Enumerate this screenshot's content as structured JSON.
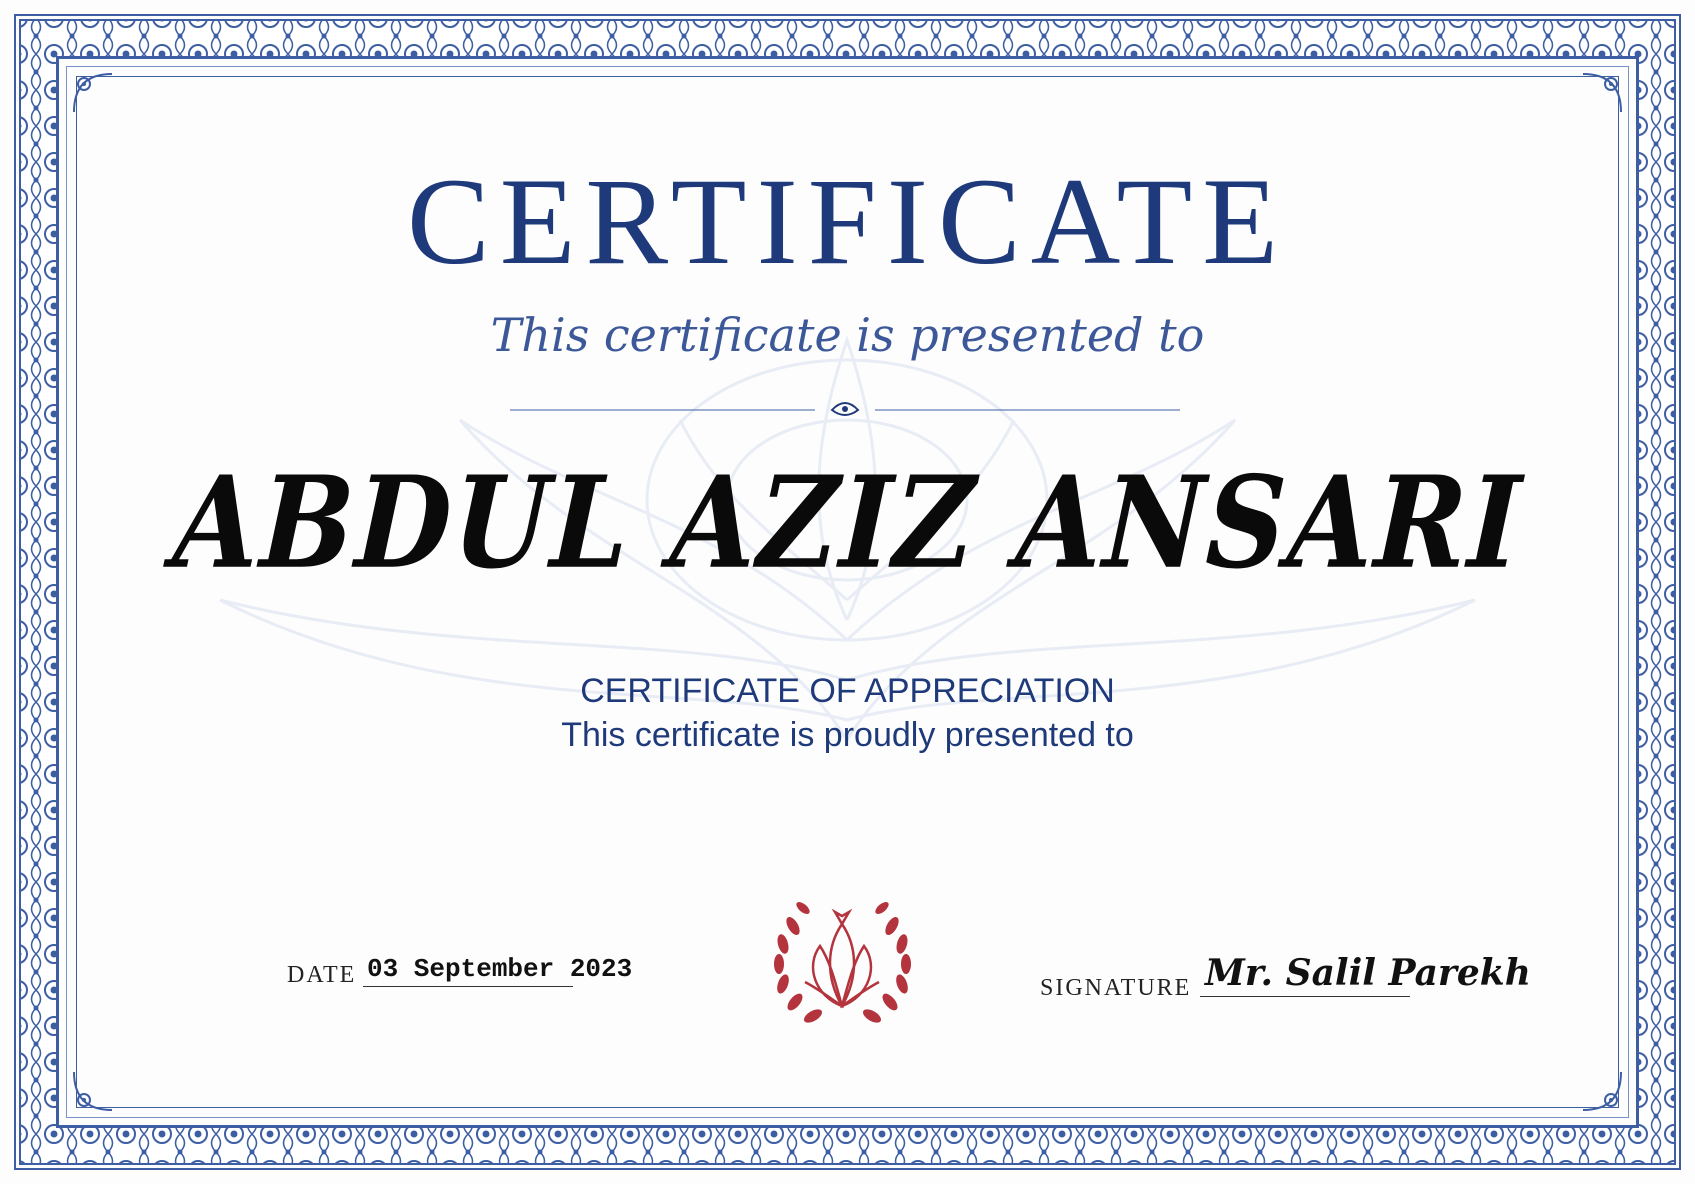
{
  "certificate": {
    "title": "CERTIFICATE",
    "subtitle": "This certificate is presented to",
    "recipient_name": "ABDUL AZIZ ANSARI",
    "appreciation": "CERTIFICATE OF APPRECIATION",
    "proudly_presented": "This certificate is proudly presented to",
    "date_label": "DATE",
    "date_value": "03 September 2023",
    "signature_label": "SIGNATURE",
    "signature_value": "Mr. Salil Parekh"
  },
  "colors": {
    "border": "#3d5ea3",
    "title": "#1f3a7a",
    "seal": "#b3343c"
  }
}
